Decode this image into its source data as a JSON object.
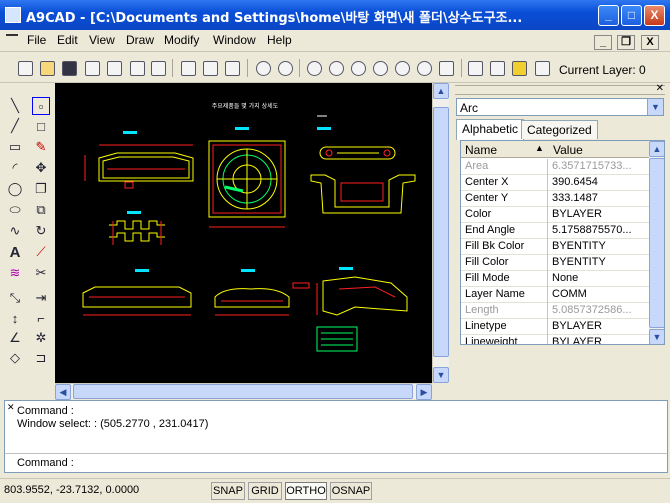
{
  "window": {
    "title": "A9CAD - [C:\\Documents and Settings\\home\\바탕 화면\\새 폴더\\상수도구조...",
    "minimize_label": "_",
    "maximize_label": "□",
    "close_label": "X"
  },
  "menu": {
    "items": [
      "File",
      "Edit",
      "View",
      "Draw",
      "Modify",
      "Window",
      "Help"
    ],
    "mdi_minimize": "_",
    "mdi_restore": "❐",
    "mdi_close": "X"
  },
  "toolbar": {
    "current_layer_label": "Current Layer: 0"
  },
  "drawing": {
    "title": "주요제품들 몇 가지 상세도"
  },
  "properties": {
    "selected_object": "Arc",
    "tabs": [
      "Alphabetic",
      "Categorized"
    ],
    "active_tab": "Alphabetic",
    "columns": [
      "Name",
      "Value"
    ],
    "rows": [
      {
        "name": "Area",
        "value": "6.3571715733...",
        "disabled": true
      },
      {
        "name": "Center X",
        "value": "390.6454",
        "disabled": false
      },
      {
        "name": "Center Y",
        "value": "333.1487",
        "disabled": false
      },
      {
        "name": "Color",
        "value": "BYLAYER",
        "disabled": false
      },
      {
        "name": "End Angle",
        "value": "5.1758875570...",
        "disabled": false
      },
      {
        "name": "Fill Bk Color",
        "value": "BYENTITY",
        "disabled": false
      },
      {
        "name": "Fill Color",
        "value": "BYENTITY",
        "disabled": false
      },
      {
        "name": "Fill Mode",
        "value": "None",
        "disabled": false
      },
      {
        "name": "Layer Name",
        "value": "COMM",
        "disabled": false
      },
      {
        "name": "Length",
        "value": "5.0857372586...",
        "disabled": true
      },
      {
        "name": "Linetype",
        "value": "BYLAYER",
        "disabled": false
      },
      {
        "name": "Lineweight",
        "value": "BYLAYER",
        "disabled": false
      }
    ]
  },
  "command": {
    "lines": [
      "Command :",
      "Window  select: : (505.2770 , 231.0417)"
    ],
    "prompt": "Command :"
  },
  "status": {
    "coordinates": "803.9552, -23.7132, 0.0000",
    "buttons": [
      "SNAP",
      "GRID",
      "ORTHO",
      "OSNAP"
    ]
  },
  "colors": {
    "title_bar": "#0a4fd8",
    "canvas_bg": "#000000",
    "cad_cyan": "#00e5ff",
    "cad_yellow": "#ffff00",
    "cad_red": "#ff2020"
  }
}
